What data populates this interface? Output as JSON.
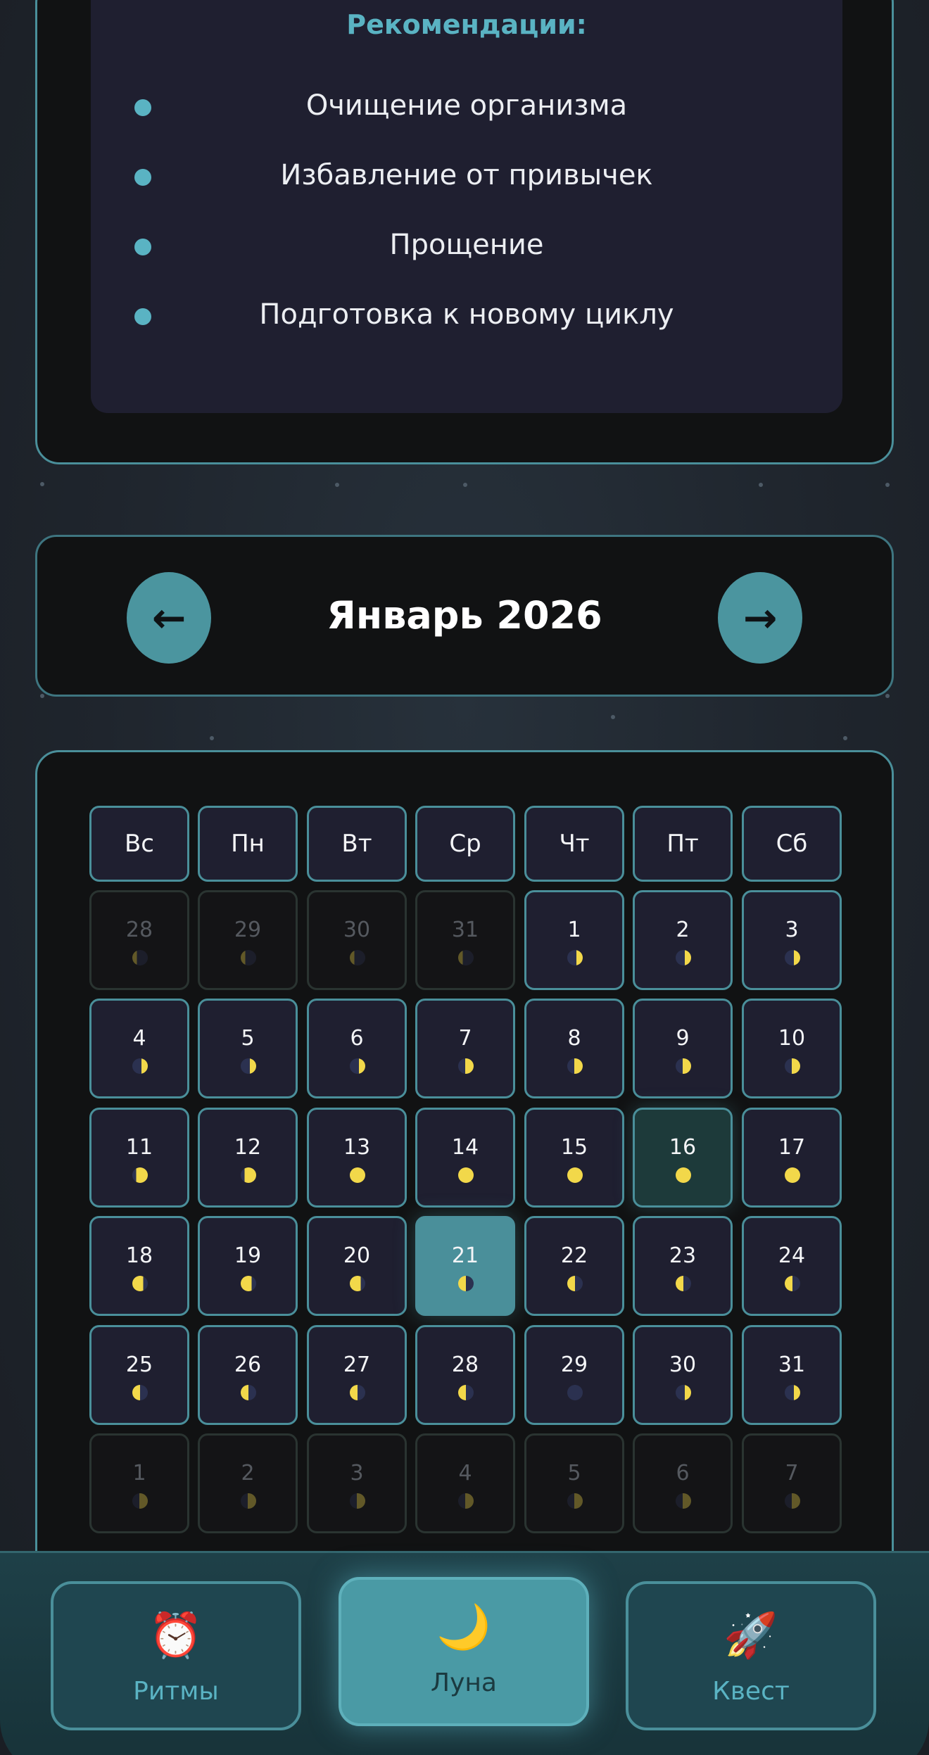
{
  "recommendations": {
    "title": "Рекомендации:",
    "items": [
      "Очищение организма",
      "Избавление от привычек",
      "Прощение",
      "Подготовка к новому циклу"
    ]
  },
  "calendar": {
    "month_title": "Январь 2026",
    "prev_icon": "←",
    "next_icon": "→",
    "weekdays": [
      "Вс",
      "Пн",
      "Вт",
      "Ср",
      "Чт",
      "Пт",
      "Сб"
    ],
    "weeks": [
      [
        {
          "d": "28",
          "m": true
        },
        {
          "d": "29",
          "m": true
        },
        {
          "d": "30",
          "m": true
        },
        {
          "d": "31",
          "m": true
        },
        {
          "d": "1"
        },
        {
          "d": "2"
        },
        {
          "d": "3"
        }
      ],
      [
        {
          "d": "4"
        },
        {
          "d": "5"
        },
        {
          "d": "6"
        },
        {
          "d": "7"
        },
        {
          "d": "8"
        },
        {
          "d": "9"
        },
        {
          "d": "10"
        }
      ],
      [
        {
          "d": "11"
        },
        {
          "d": "12"
        },
        {
          "d": "13"
        },
        {
          "d": "14"
        },
        {
          "d": "15"
        },
        {
          "d": "16",
          "hl": true
        },
        {
          "d": "17"
        }
      ],
      [
        {
          "d": "18"
        },
        {
          "d": "19"
        },
        {
          "d": "20"
        },
        {
          "d": "21",
          "today": true
        },
        {
          "d": "22"
        },
        {
          "d": "23"
        },
        {
          "d": "24"
        }
      ],
      [
        {
          "d": "25"
        },
        {
          "d": "26"
        },
        {
          "d": "27"
        },
        {
          "d": "28"
        },
        {
          "d": "29"
        },
        {
          "d": "30"
        },
        {
          "d": "31"
        }
      ],
      [
        {
          "d": "1",
          "m": true
        },
        {
          "d": "2",
          "m": true
        },
        {
          "d": "3",
          "m": true
        },
        {
          "d": "4",
          "m": true
        },
        {
          "d": "5",
          "m": true
        },
        {
          "d": "6",
          "m": true
        },
        {
          "d": "7",
          "m": true
        }
      ]
    ]
  },
  "bottom_nav": {
    "tabs": [
      {
        "label": "Ритмы",
        "icon": "⏰",
        "icon_name": "alarm-clock-icon"
      },
      {
        "label": "Луна",
        "icon": "🌙",
        "icon_name": "crescent-moon-icon",
        "active": true
      },
      {
        "label": "Квест",
        "icon": "🚀",
        "icon_name": "rocket-icon"
      }
    ]
  },
  "colors": {
    "accent": "#5ab3c3",
    "border": "#4a8f9a",
    "cell_bg": "#1f1f30",
    "moon_lit": "#f2d84a",
    "moon_dark": "#2b3150"
  }
}
